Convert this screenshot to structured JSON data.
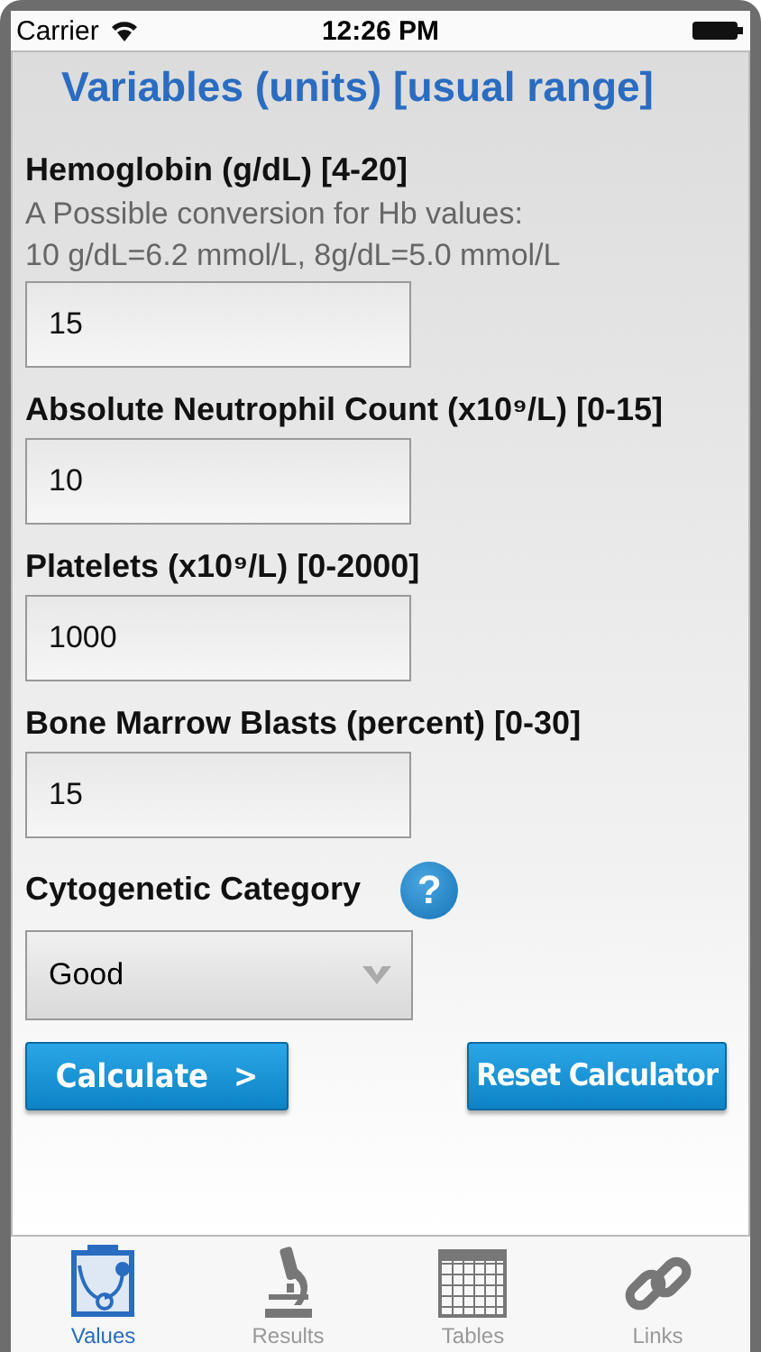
{
  "status_bar": {
    "carrier": "Carrier",
    "time": "12:26 PM"
  },
  "heading": "Variables (units) [usual range]",
  "fields": [
    {
      "label": "Hemoglobin (g/dL) [4-20]",
      "value": "15",
      "notes": [
        "A Possible conversion for Hb values:",
        "10 g/dL=6.2 mmol/L, 8g/dL=5.0 mmol/L"
      ]
    },
    {
      "label": "Absolute Neutrophil Count (x10⁹/L) [0-15]",
      "value": "10"
    },
    {
      "label": "Platelets (x10⁹/L) [0-2000]",
      "value": "1000"
    },
    {
      "label": "Bone Marrow Blasts (percent) [0-30]",
      "value": "15"
    }
  ],
  "cytogenetic": {
    "label": "Cytogenetic Category",
    "help": "?",
    "value": "Good"
  },
  "buttons": [
    {
      "kind": "calculate",
      "label": "Calculate",
      "arrow": ">"
    },
    {
      "kind": "reset",
      "label": "Reset Calculator"
    }
  ],
  "tabs": [
    {
      "label": "Values",
      "kind": "clipboard",
      "selected": true
    },
    {
      "label": "Results",
      "kind": "microscope",
      "selected": false
    },
    {
      "label": "Tables",
      "kind": "grid",
      "selected": false
    },
    {
      "label": "Links",
      "kind": "link",
      "selected": false
    }
  ]
}
